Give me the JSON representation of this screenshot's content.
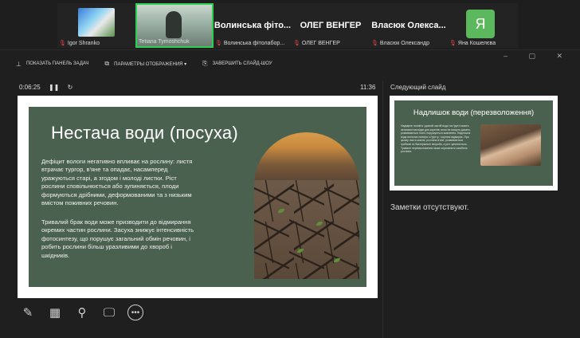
{
  "participants": [
    {
      "kind": "image",
      "name": "Igor Shranko",
      "muted": true
    },
    {
      "kind": "camera",
      "name": "Tetiana Tymoshchuk",
      "muted": false,
      "active": true
    },
    {
      "kind": "text",
      "title": "Волинська фіто...",
      "name": "Волинська фітолабор...",
      "muted": true
    },
    {
      "kind": "text",
      "title": "ОЛЕГ ВЕНГЕР",
      "name": "ОЛЕГ ВЕНГЕР",
      "muted": true
    },
    {
      "kind": "text",
      "title": "Власюк Олекса...",
      "name": "Власюк Олександр",
      "muted": true
    },
    {
      "kind": "avatar",
      "initial": "Я",
      "name": "Яна Кошелєва",
      "muted": true
    }
  ],
  "toolbar": {
    "show_taskbar": "ПОКАЗАТЬ ПАНЕЛЬ ЗАДАЧ",
    "display_settings": "ПАРАМЕТРЫ ОТОБРАЖЕНИЯ ▾",
    "end_show": "ЗАВЕРШИТЬ СЛАЙД-ШОУ"
  },
  "window_controls": "– ▢ ✕",
  "timer": {
    "elapsed": "0:06:25",
    "pause": "❚❚",
    "reset": "↻"
  },
  "clock": "11:36",
  "current_slide": {
    "title": "Нестача води (посуха)",
    "paragraph1": "Дефіцит вологи негативно впливає на рослину: листя втрачає тургор, в'яне та опадає, насамперед уражуються старі, а згодом і молоді листки. Ріст рослини сповільнюється або зупиняється, плоди формуються дрібними, деформованими та з низьким вмістом поживних речовин.",
    "paragraph2": "Тривалий брак води може призводити до відмирання окремих частин рослини. Засуха знижує інтенсивність фотосинтезу, що порушує загальний обмін речовин, і робить рослини більш уразливими до хвороб і шкідників."
  },
  "next_slide": {
    "label": "Следующий слайд",
    "title": "Надлишок води (перезволоження)",
    "body": "Надмірне полив'я і довгий застій води на ґрунті мають негативні наслідки для коренів: вони не можуть дихати, розвиваються гнилі, порушується живлення. Надлишок води витісняє повітря з ґрунту, і коріння відмирає. При цьому листя жовтіє, рослина в'яне, розвиваються грибкові та бактеріальні хвороби, а ріст зупиняється. Тривале перезволоження може спричинити загибель рослини."
  },
  "notes": "Заметки отсутствуют.",
  "tools": [
    "pen-icon",
    "slides-grid-icon",
    "zoom-icon",
    "presenter-screen-icon",
    "more-icon"
  ],
  "accent_color": "#2fce4f",
  "slide_bg_color": "#4b6150"
}
